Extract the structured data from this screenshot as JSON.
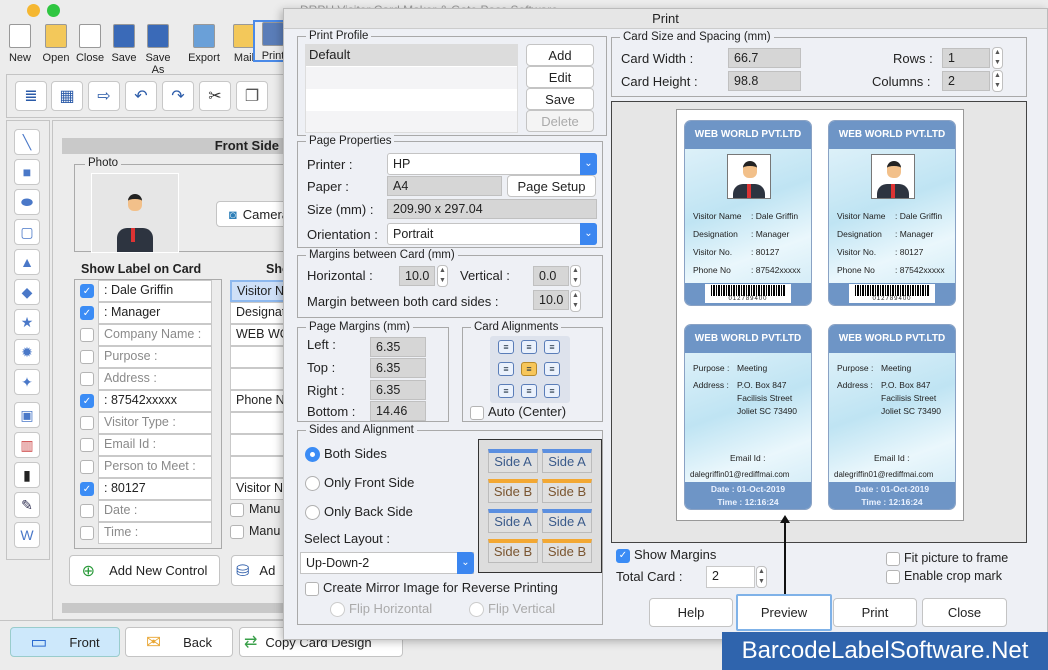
{
  "app": {
    "title": "DRPU Visitor Card Maker & Gate Pass Software"
  },
  "toolbar": [
    {
      "label": "New",
      "icon": "new-file-icon"
    },
    {
      "label": "Open",
      "icon": "open-folder-icon"
    },
    {
      "label": "Close",
      "icon": "close-file-icon"
    },
    {
      "label": "Save",
      "icon": "save-icon"
    },
    {
      "label": "Save As",
      "icon": "save-as-icon"
    },
    {
      "label": "Export",
      "icon": "export-icon"
    },
    {
      "label": "Mail",
      "icon": "mail-icon"
    },
    {
      "label": "Print",
      "icon": "printer-icon"
    }
  ],
  "front_panel": {
    "header": "Front Side",
    "photo_group": "Photo",
    "camera": "Camera",
    "show_label_heading": "Show Label on Card",
    "show_value_heading": "Sho",
    "rows": [
      {
        "checked": true,
        "text": ": Dale Griffin",
        "right": "Visitor N"
      },
      {
        "checked": true,
        "text": ": Manager",
        "right": "Designat"
      },
      {
        "checked": false,
        "text": "Company Name :",
        "right": "WEB WO"
      },
      {
        "checked": false,
        "text": "Purpose :",
        "right": ""
      },
      {
        "checked": false,
        "text": "Address :",
        "right": ""
      },
      {
        "checked": true,
        "text": ": 87542xxxxx",
        "right": "Phone N"
      },
      {
        "checked": false,
        "text": "Visitor Type :",
        "right": ""
      },
      {
        "checked": false,
        "text": "Email Id :",
        "right": ""
      },
      {
        "checked": false,
        "text": "Person to Meet :",
        "right": ""
      },
      {
        "checked": true,
        "text": ": 80127",
        "right": "Visitor N"
      },
      {
        "checked": false,
        "text": "Date :",
        "right": "Manu"
      },
      {
        "checked": false,
        "text": "Time :",
        "right": "Manu"
      }
    ],
    "add_new_control": "Add New Control",
    "add_db": "Ad"
  },
  "bottom_tabs": {
    "front": "Front",
    "back": "Back",
    "copy": "Copy Card Design"
  },
  "dialog": {
    "title": "Print",
    "print_profile": {
      "legend": "Print Profile",
      "items": [
        "Default"
      ],
      "add": "Add",
      "edit": "Edit",
      "save": "Save",
      "delete": "Delete"
    },
    "page_properties": {
      "legend": "Page Properties",
      "printer_label": "Printer :",
      "printer": "HP",
      "paper_label": "Paper :",
      "paper": "A4",
      "page_setup": "Page Setup",
      "size_label": "Size (mm) :",
      "size": "209.90 x 297.04",
      "orientation_label": "Orientation :",
      "orientation": "Portrait"
    },
    "margins_between": {
      "legend": "Margins between Card (mm)",
      "horizontal_label": "Horizontal :",
      "horizontal": "10.0",
      "vertical_label": "Vertical :",
      "vertical": "0.0",
      "both_sides_label": "Margin between both card sides :",
      "both_sides": "10.0"
    },
    "page_margins": {
      "legend": "Page Margins (mm)",
      "left_label": "Left :",
      "left": "6.35",
      "top_label": "Top :",
      "top": "6.35",
      "right_label": "Right :",
      "right": "6.35",
      "bottom_label": "Bottom :",
      "bottom": "14.46"
    },
    "card_alignments": {
      "legend": "Card Alignments",
      "selected": "middle-center",
      "auto": "Auto (Center)",
      "auto_checked": false
    },
    "sides": {
      "legend": "Sides and Alignment",
      "both": "Both Sides",
      "front": "Only Front Side",
      "back": "Only Back Side",
      "selected": "both",
      "layout_label": "Select Layout :",
      "layout": "Up-Down-2",
      "side_a": "Side A",
      "side_b": "Side B",
      "mirror": "Create Mirror Image for Reverse Printing",
      "flip_h": "Flip Horizontal",
      "flip_v": "Flip Vertical"
    },
    "card_size": {
      "legend": "Card Size and Spacing (mm)",
      "width_label": "Card Width :",
      "width": "66.7",
      "height_label": "Card Height :",
      "height": "98.8",
      "rows_label": "Rows :",
      "rows": "1",
      "columns_label": "Columns :",
      "columns": "2"
    },
    "preview_cards": {
      "company": "WEB WORLD PVT.LTD",
      "front": [
        [
          "Visitor Name",
          ": Dale Griffin"
        ],
        [
          "Designation",
          ": Manager"
        ],
        [
          "Visitor No.",
          ": 80127"
        ],
        [
          "Phone No",
          ": 87542xxxxx"
        ]
      ],
      "barcode": "012789400",
      "purpose_label": "Purpose :",
      "purpose": "Meeting",
      "address_label": "Address :",
      "address": [
        "P.O. Box 847",
        "Facilisis Street",
        "Joliet SC 73490"
      ],
      "email_label": "Email Id :",
      "email": "dalegriffin01@rediffmai.com",
      "date": "Date : 01-Oct-2019",
      "time": "Time : 12:16:24"
    },
    "show_margins": "Show Margins",
    "show_margins_checked": true,
    "total_card_label": "Total Card :",
    "total_card": "2",
    "fit_picture": "Fit picture to frame",
    "crop_mark": "Enable crop mark",
    "buttons": {
      "help": "Help",
      "preview": "Preview",
      "print": "Print",
      "close": "Close"
    }
  },
  "watermark": "BarcodeLabelSoftware.Net",
  "colors": {
    "accent": "#3b8cf5",
    "card_header": "#6e95c6",
    "watermark_bg": "#2f64ad"
  }
}
